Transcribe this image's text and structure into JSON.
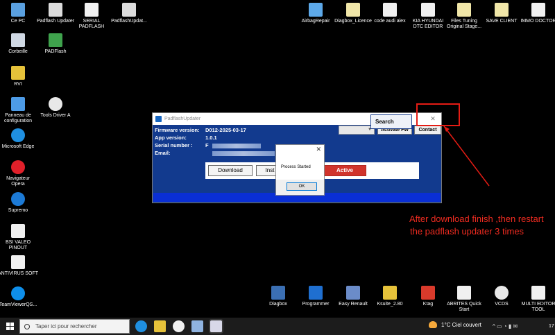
{
  "desktop": {
    "icons": [
      {
        "label": "Ce PC",
        "color": "#5aa0e0"
      },
      {
        "label": "Padflash Updater",
        "color": "#dcdcdc"
      },
      {
        "label": "SERIAL\nPADFLASH",
        "color": "#f2f2f2"
      },
      {
        "label": "PadflashUpdat...",
        "color": "#dcdcdc"
      },
      {
        "label": "Corbeille",
        "color": "#cfd8e3"
      },
      {
        "label": "PADFlash",
        "color": "#3fa34d"
      },
      {
        "label": "RVI",
        "color": "#e6c23a"
      },
      {
        "label": "Panneau de\nconfiguration",
        "color": "#4d9be6"
      },
      {
        "label": "Tools Driver A",
        "color": "#e8e8e8"
      },
      {
        "label": "Microsoft Edge",
        "color": "#1f8fe0"
      },
      {
        "label": "Navigateur\nOpera",
        "color": "#e0202a"
      },
      {
        "label": "Supremo",
        "color": "#1c7ad6"
      },
      {
        "label": "BSI VALEO\nPINOUT",
        "color": "#f0f0f0"
      },
      {
        "label": "ANTIVIRUS SOFT",
        "color": "#f0f0f0"
      },
      {
        "label": "TeamViewerQS...",
        "color": "#0e8ee9"
      },
      {
        "label": "AirbagRepair",
        "color": "#5da9e9"
      },
      {
        "label": "Diagbox_Licence",
        "color": "#f0e6a8"
      },
      {
        "label": "code audi alex",
        "color": "#f0f0f0"
      },
      {
        "label": "KIA HYUNDAI\nDTC EDITOR",
        "color": "#f0f0f0"
      },
      {
        "label": "Files Tuning\nOriginal Stage...",
        "color": "#f0e6a8"
      },
      {
        "label": "SAVE CLIENT",
        "color": "#f0e6a8"
      },
      {
        "label": "IMMO DOCTOR",
        "color": "#f0f0f0"
      },
      {
        "label": "Diagbox",
        "color": "#3b6fb3"
      },
      {
        "label": "Programmer",
        "color": "#1f6fd0"
      },
      {
        "label": "Easy Renault",
        "color": "#6b8cc9"
      },
      {
        "label": "Ksuite_2.80",
        "color": "#e6c23a"
      },
      {
        "label": "Ktag",
        "color": "#d93a2b"
      },
      {
        "label": "ABRITES Quick\nStart",
        "color": "#f0f0f0"
      },
      {
        "label": "VCDS",
        "color": "#e8e8e8"
      },
      {
        "label": "MULTI EDITOR\nTOOL",
        "color": "#f0f0f0"
      }
    ]
  },
  "window": {
    "title": "PadflashUpdater",
    "close": "✕",
    "firmware_label": "Firmware version:",
    "firmware_value": "D012-2025-03-17",
    "app_label": "App version:",
    "app_value": "1.0.1",
    "serial_label": "Serial number :",
    "serial_value": "F",
    "email_label": "Email:",
    "activate_fw": "Activate FW",
    "contact": "Contact",
    "download": "Download",
    "install": "Inst",
    "active": "Active",
    "search": "Search"
  },
  "dialog": {
    "close": "✕",
    "message": "Process Started",
    "ok": "OK"
  },
  "annotation": {
    "line1": "After download finish ,then restart",
    "line2": "the padflash updater 3 times",
    "color": "#ee2b20"
  },
  "taskbar": {
    "search_placeholder": "Taper ici pour rechercher",
    "weather": "1°C  Ciel couvert",
    "tray": "^ ▭ ◔ ▮ ✉",
    "clock": "17"
  }
}
